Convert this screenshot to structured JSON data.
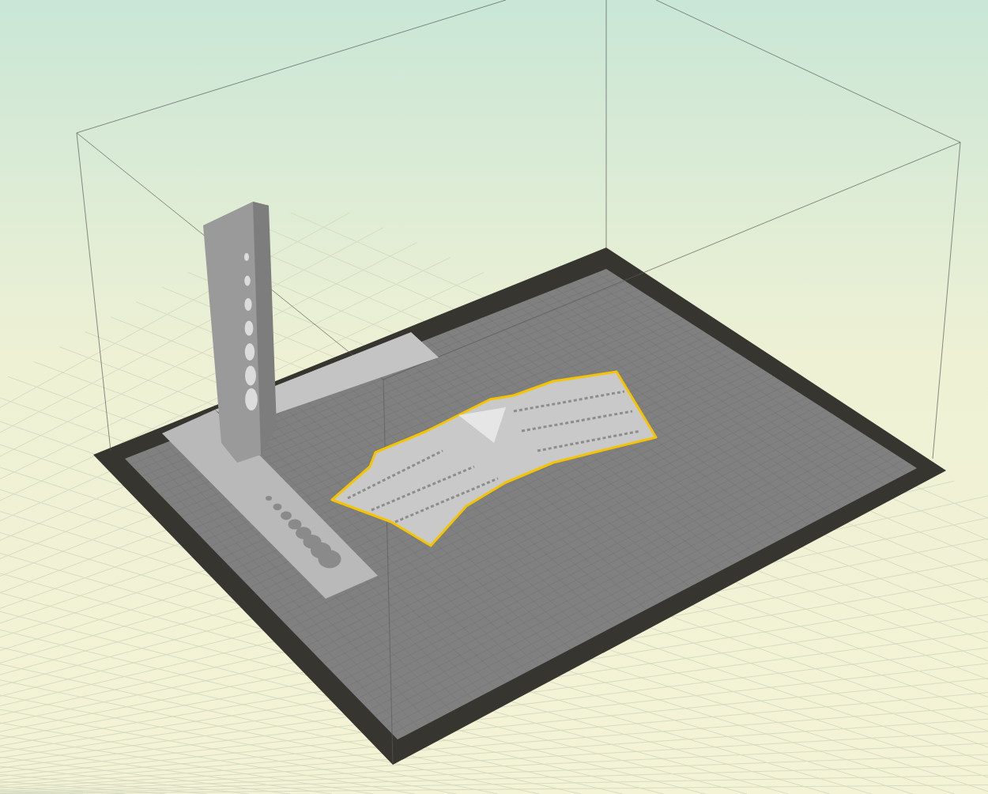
{
  "viewport": {
    "objects": [
      {
        "kind": "ruler",
        "selected": false
      },
      {
        "kind": "curved-plate",
        "selected": true
      }
    ]
  }
}
